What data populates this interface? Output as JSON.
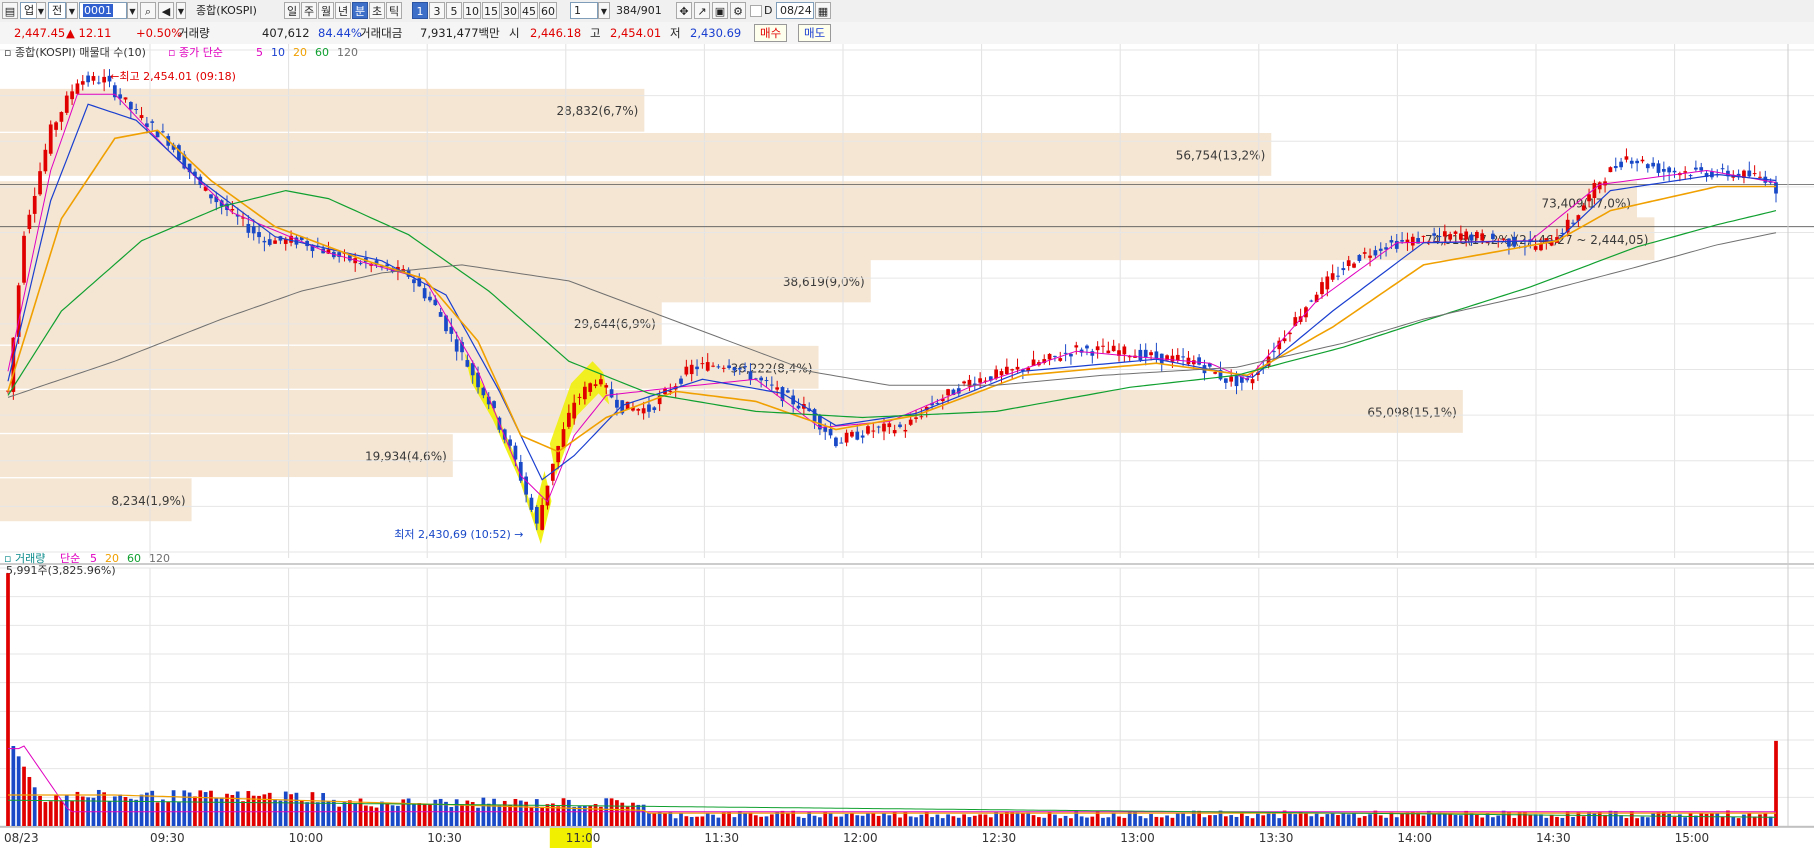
{
  "toolbar": {
    "market_dropdown": "업",
    "period_dropdown": "전",
    "code": "0001",
    "name": "종합(KOSPI)",
    "period_tabs": [
      "일",
      "주",
      "월",
      "년",
      "분",
      "초",
      "틱"
    ],
    "active_period": "분",
    "interval_buttons": [
      "1",
      "3",
      "5",
      "10",
      "15",
      "30",
      "45",
      "60"
    ],
    "active_interval": "1",
    "interval_value": "1",
    "count": "384/901",
    "checkbox_d": "D",
    "date": "08/24"
  },
  "quote": {
    "price": "2,447.45",
    "change": "▲ 12.11",
    "change_pct": "+0.50%",
    "volume_label": "거래량",
    "volume": "407,612",
    "volume_pct": "84.44%",
    "amount_label": "거래대금",
    "amount": "7,931,477백만",
    "open_label": "시",
    "open": "2,446.18",
    "high_label": "고",
    "high": "2,454.01",
    "low_label": "저",
    "low": "2,430.69",
    "buy": "매수",
    "sell": "매도"
  },
  "colors": {
    "up": "#e00000",
    "down": "#1a49c8",
    "ma5": "#e000c0",
    "ma10": "#1a3fd0",
    "ma20": "#f0a000",
    "ma60": "#10a030",
    "ma120": "#707070",
    "profile": "#f5e6d3",
    "highlight": "#f0f000"
  },
  "chart_data": {
    "type": "candlestick",
    "legend_main": {
      "title": "종합(KOSPI) 매물대 수(10)",
      "ma_label": "종가 단순",
      "periods": [
        "5",
        "10",
        "20",
        "60",
        "120"
      ]
    },
    "legend_volume": {
      "title": "거래량",
      "ma_label": "단순",
      "periods": [
        "5",
        "20",
        "60",
        "120"
      ],
      "max_text": "5,991주(3,825.96%)"
    },
    "high_marker": "최고 2,454.01 (09:18)",
    "low_marker": "최저 2,430,69 (10:52)",
    "date_label": "08/23",
    "x_ticks": [
      "09:30",
      "10:00",
      "10:30",
      "11:00",
      "11:30",
      "12:00",
      "12:30",
      "13:00",
      "13:30",
      "14:00",
      "14:30",
      "15:00"
    ],
    "highlighted_tick": "11:00",
    "ylim": [
      2430,
      2455
    ],
    "volume_profile": [
      {
        "label": "28,832(6,7%)",
        "price": 2452.0,
        "length": 0.37
      },
      {
        "label": "56,754(13,2%)",
        "price": 2449.8,
        "length": 0.73
      },
      {
        "label": "73,409(17,0%)",
        "price": 2447.4,
        "length": 0.94
      },
      {
        "label": "74,018(17,2%)(2,446,27 ~ 2,444,05)",
        "price": 2445.6,
        "length": 0.95
      },
      {
        "label": "38,619(9,0%)",
        "price": 2443.5,
        "length": 0.5
      },
      {
        "label": "29,644(6,9%)",
        "price": 2441.4,
        "length": 0.38
      },
      {
        "label": "36,222(8,4%)",
        "price": 2439.2,
        "length": 0.47
      },
      {
        "label": "65,098(15,1%)",
        "price": 2437.0,
        "length": 0.84
      },
      {
        "label": "19,934(4,6%)",
        "price": 2434.8,
        "length": 0.26
      },
      {
        "label": "8,234(1,9%)",
        "price": 2432.6,
        "length": 0.11
      }
    ],
    "price_path": [
      [
        0,
        2438
      ],
      [
        3,
        2446
      ],
      [
        8,
        2451
      ],
      [
        13,
        2453.5
      ],
      [
        18,
        2453.5
      ],
      [
        24,
        2451.8
      ],
      [
        30,
        2450.5
      ],
      [
        36,
        2448.2
      ],
      [
        42,
        2446.8
      ],
      [
        48,
        2445.5
      ],
      [
        55,
        2445.5
      ],
      [
        62,
        2444.7
      ],
      [
        68,
        2444.3
      ],
      [
        75,
        2443.8
      ],
      [
        80,
        2442.2
      ],
      [
        85,
        2439.8
      ],
      [
        90,
        2437.5
      ],
      [
        95,
        2434.5
      ],
      [
        99,
        2431.3
      ],
      [
        102,
        2434.5
      ],
      [
        106,
        2437.5
      ],
      [
        110,
        2438.6
      ],
      [
        115,
        2437.2
      ],
      [
        120,
        2437.1
      ],
      [
        128,
        2439.2
      ],
      [
        135,
        2439.4
      ],
      [
        142,
        2438.3
      ],
      [
        150,
        2437.0
      ],
      [
        155,
        2435.5
      ],
      [
        162,
        2436.1
      ],
      [
        168,
        2436.2
      ],
      [
        172,
        2437.2
      ],
      [
        180,
        2438.5
      ],
      [
        188,
        2439
      ],
      [
        195,
        2439.6
      ],
      [
        200,
        2440.1
      ],
      [
        208,
        2440
      ],
      [
        215,
        2439.7
      ],
      [
        222,
        2439.5
      ],
      [
        228,
        2438.6
      ],
      [
        232,
        2438.4
      ],
      [
        238,
        2440.5
      ],
      [
        245,
        2443
      ],
      [
        252,
        2444.6
      ],
      [
        258,
        2445.3
      ],
      [
        265,
        2445.6
      ],
      [
        272,
        2445.8
      ],
      [
        280,
        2445.5
      ],
      [
        287,
        2445.2
      ],
      [
        293,
        2446.5
      ],
      [
        298,
        2448.5
      ],
      [
        303,
        2449.7
      ],
      [
        310,
        2449.0
      ],
      [
        318,
        2448.9
      ],
      [
        324,
        2448.8
      ],
      [
        330,
        2448.6
      ],
      [
        331,
        2447.6
      ]
    ],
    "ma_paths": {
      "ma5": [
        [
          0,
          2439
        ],
        [
          8,
          2449
        ],
        [
          13,
          2452.8
        ],
        [
          20,
          2452.8
        ],
        [
          30,
          2450
        ],
        [
          42,
          2446.9
        ],
        [
          60,
          2444.9
        ],
        [
          78,
          2443.6
        ],
        [
          88,
          2439
        ],
        [
          96,
          2433.8
        ],
        [
          101,
          2432.5
        ],
        [
          106,
          2435.8
        ],
        [
          112,
          2437.8
        ],
        [
          125,
          2438.2
        ],
        [
          140,
          2438.6
        ],
        [
          152,
          2436.2
        ],
        [
          165,
          2436.5
        ],
        [
          180,
          2438.2
        ],
        [
          200,
          2440
        ],
        [
          225,
          2439.4
        ],
        [
          232,
          2438.6
        ],
        [
          245,
          2442.5
        ],
        [
          260,
          2445.4
        ],
        [
          285,
          2445.5
        ],
        [
          298,
          2448.3
        ],
        [
          318,
          2449
        ],
        [
          331,
          2448.4
        ]
      ],
      "ma10": [
        [
          0,
          2438.5
        ],
        [
          8,
          2447.5
        ],
        [
          15,
          2452.3
        ],
        [
          24,
          2451.5
        ],
        [
          36,
          2448.5
        ],
        [
          50,
          2445.7
        ],
        [
          70,
          2444.5
        ],
        [
          82,
          2442.8
        ],
        [
          92,
          2438
        ],
        [
          100,
          2433.6
        ],
        [
          106,
          2434.8
        ],
        [
          115,
          2437.3
        ],
        [
          130,
          2438.6
        ],
        [
          145,
          2437.9
        ],
        [
          155,
          2436.3
        ],
        [
          170,
          2436.9
        ],
        [
          190,
          2439
        ],
        [
          215,
          2439.6
        ],
        [
          233,
          2438.7
        ],
        [
          248,
          2442
        ],
        [
          265,
          2445.4
        ],
        [
          290,
          2445.5
        ],
        [
          300,
          2448
        ],
        [
          320,
          2448.8
        ],
        [
          331,
          2448.5
        ]
      ],
      "ma20": [
        [
          0,
          2438
        ],
        [
          10,
          2446.6
        ],
        [
          20,
          2450.6
        ],
        [
          28,
          2451
        ],
        [
          38,
          2448.5
        ],
        [
          50,
          2446.2
        ],
        [
          66,
          2444.6
        ],
        [
          78,
          2443.6
        ],
        [
          88,
          2440.5
        ],
        [
          96,
          2435.8
        ],
        [
          103,
          2435
        ],
        [
          112,
          2436.7
        ],
        [
          125,
          2438
        ],
        [
          140,
          2437.5
        ],
        [
          155,
          2436.1
        ],
        [
          170,
          2436.8
        ],
        [
          190,
          2438.8
        ],
        [
          215,
          2439.4
        ],
        [
          232,
          2438.8
        ],
        [
          248,
          2441.2
        ],
        [
          265,
          2444.3
        ],
        [
          290,
          2445.5
        ],
        [
          300,
          2447
        ],
        [
          320,
          2448.2
        ],
        [
          331,
          2448.2
        ]
      ],
      "ma60": [
        [
          0,
          2437.8
        ],
        [
          10,
          2442
        ],
        [
          25,
          2445.5
        ],
        [
          40,
          2447.2
        ],
        [
          52,
          2448
        ],
        [
          60,
          2447.6
        ],
        [
          75,
          2445.8
        ],
        [
          90,
          2443
        ],
        [
          105,
          2439.5
        ],
        [
          120,
          2437.9
        ],
        [
          140,
          2437
        ],
        [
          160,
          2436.7
        ],
        [
          185,
          2437
        ],
        [
          210,
          2438.2
        ],
        [
          230,
          2438.8
        ],
        [
          250,
          2440.2
        ],
        [
          265,
          2441.5
        ],
        [
          285,
          2443.2
        ],
        [
          305,
          2445.2
        ],
        [
          320,
          2446.3
        ],
        [
          331,
          2447.0
        ]
      ],
      "ma120": [
        [
          0,
          2437.7
        ],
        [
          20,
          2439.5
        ],
        [
          40,
          2441.6
        ],
        [
          55,
          2443
        ],
        [
          70,
          2443.9
        ],
        [
          85,
          2444.3
        ],
        [
          105,
          2443.5
        ],
        [
          130,
          2441
        ],
        [
          150,
          2439
        ],
        [
          165,
          2438.3
        ],
        [
          185,
          2438.3
        ],
        [
          205,
          2438.8
        ],
        [
          230,
          2439.2
        ],
        [
          250,
          2440.4
        ],
        [
          265,
          2441.6
        ],
        [
          285,
          2442.8
        ],
        [
          305,
          2444.2
        ],
        [
          320,
          2445.3
        ],
        [
          331,
          2445.9
        ]
      ]
    }
  }
}
